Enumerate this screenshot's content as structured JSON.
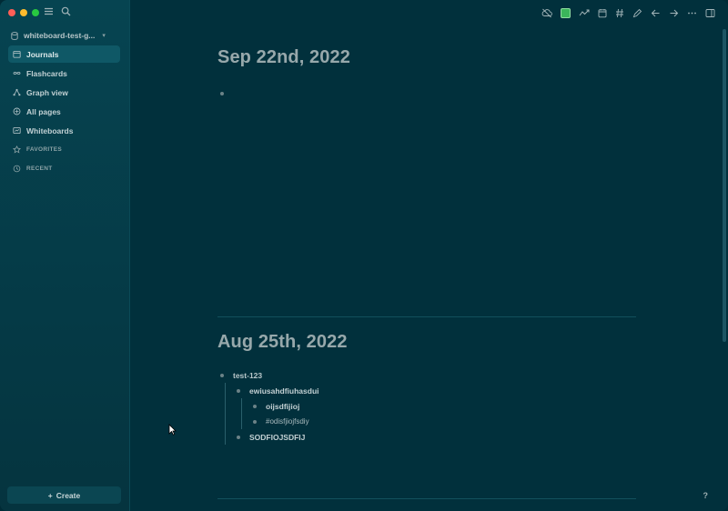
{
  "sidebar": {
    "graph_name": "whiteboard-test-g...",
    "items": [
      {
        "label": "Journals",
        "icon": "calendar-icon",
        "active": true
      },
      {
        "label": "Flashcards",
        "icon": "infinity-icon",
        "active": false
      },
      {
        "label": "Graph view",
        "icon": "graph-icon",
        "active": false
      },
      {
        "label": "All pages",
        "icon": "pages-icon",
        "active": false
      },
      {
        "label": "Whiteboards",
        "icon": "whiteboard-icon",
        "active": false
      }
    ],
    "sections": {
      "favorites": "FAVORITES",
      "recent": "RECENT"
    },
    "create_label": "Create"
  },
  "journals": [
    {
      "title": "Sep 22nd, 2022",
      "blocks": []
    },
    {
      "title": "Aug 25th, 2022",
      "blocks": [
        {
          "text": "test-123",
          "level": 0
        },
        {
          "text": "ewiusahdfiuhasdui",
          "level": 1
        },
        {
          "text": "oijsdfijioj",
          "level": 2
        },
        {
          "text": "#odisfjiojfsdiy",
          "level": 2
        },
        {
          "text": "SODFIOJSDFIJ",
          "level": 1
        }
      ]
    }
  ],
  "help_label": "?",
  "colors": {
    "background": "#01303c",
    "sidebar": "#064451",
    "accent_green": "#3bb55b"
  }
}
